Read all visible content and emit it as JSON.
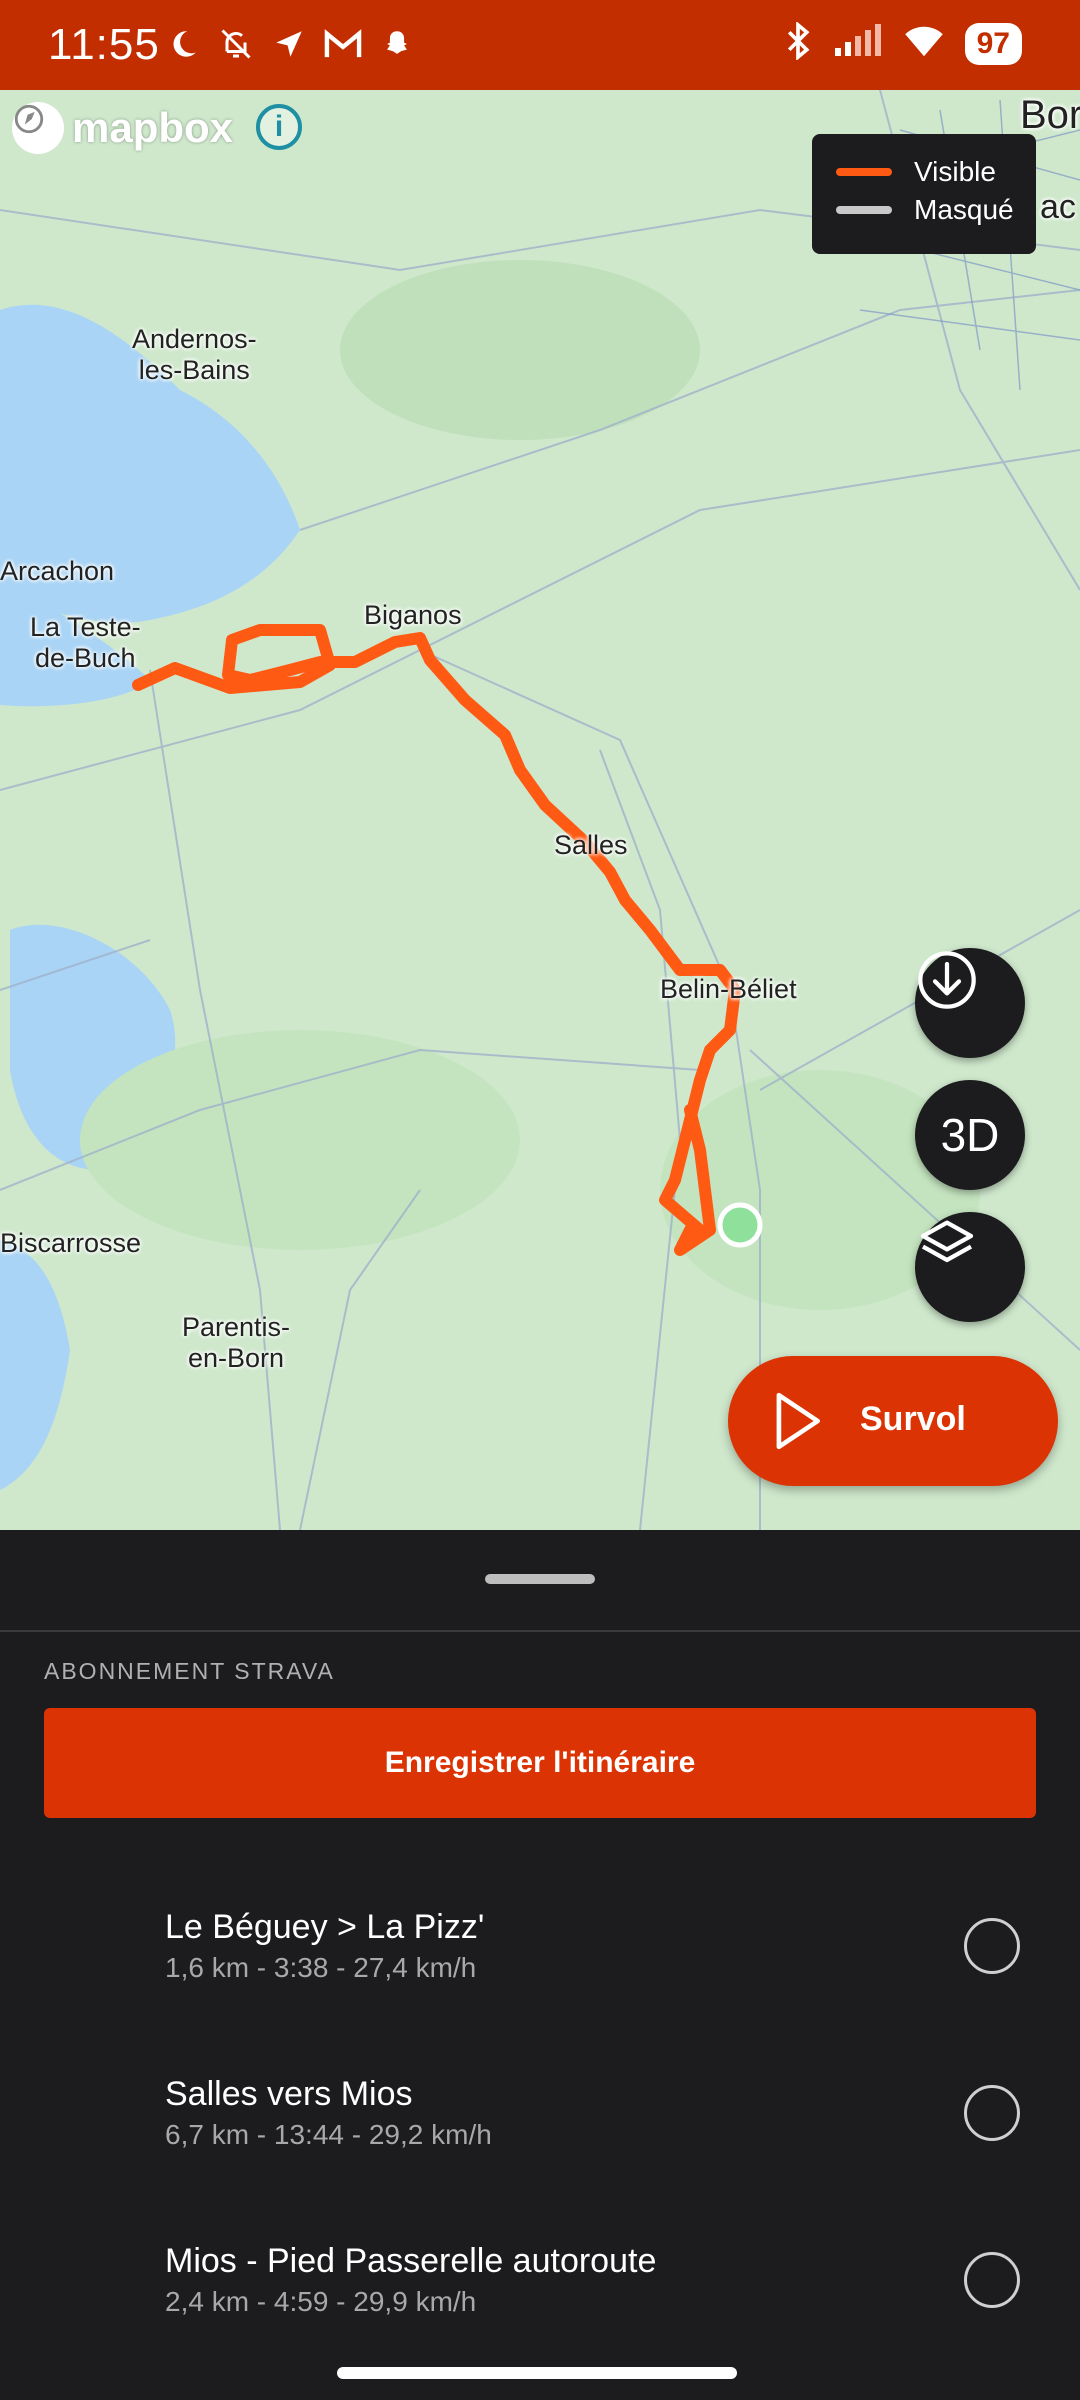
{
  "status_bar": {
    "time": "11:55",
    "battery": "97",
    "left_icons": [
      "moon-icon",
      "bell-off-icon",
      "location-arrow-icon",
      "gmail-icon",
      "snapchat-icon"
    ],
    "right_icons": [
      "bluetooth-icon",
      "signal-icon",
      "wifi-icon",
      "battery-icon"
    ]
  },
  "map": {
    "attribution": "mapbox",
    "legend": {
      "visible_label": "Visible",
      "hidden_label": "Masqué",
      "visible_color": "#ff5a14",
      "hidden_color": "#c8c8c8"
    },
    "towns": {
      "andernos": "Andernos-\nles-Bains",
      "arcachon": "Arcachon",
      "la_teste": "La Teste-\nde-Buch",
      "biganos": "Biganos",
      "salles": "Salles",
      "belin": "Belin-Béliet",
      "biscarrosse": "Biscarrosse",
      "parentis": "Parentis-\nen-Born",
      "bordeaux_partial": "Bor",
      "merignac_partial": "ac"
    },
    "route_color": "#ff5a14",
    "buttons": {
      "download_icon": "download-icon",
      "three_d_label": "3D",
      "layers_icon": "layers-icon",
      "flyover_label": "Survol"
    }
  },
  "sheet": {
    "section_label": "ABONNEMENT STRAVA",
    "save_button": "Enregistrer l'itinéraire",
    "routes": [
      {
        "title": "Le Béguey > La Pizz'",
        "stats": "1,6 km - 3:38 - 27,4 km/h"
      },
      {
        "title": "Salles vers Mios",
        "stats": "6,7 km - 13:44 - 29,2 km/h"
      },
      {
        "title": "Mios - Pied Passerelle autoroute",
        "stats": "2,4 km - 4:59 - 29,9 km/h"
      }
    ]
  },
  "colors": {
    "accent": "#db3303",
    "status_bar": "#c22e00",
    "sheet_bg": "#1c1c1e"
  }
}
